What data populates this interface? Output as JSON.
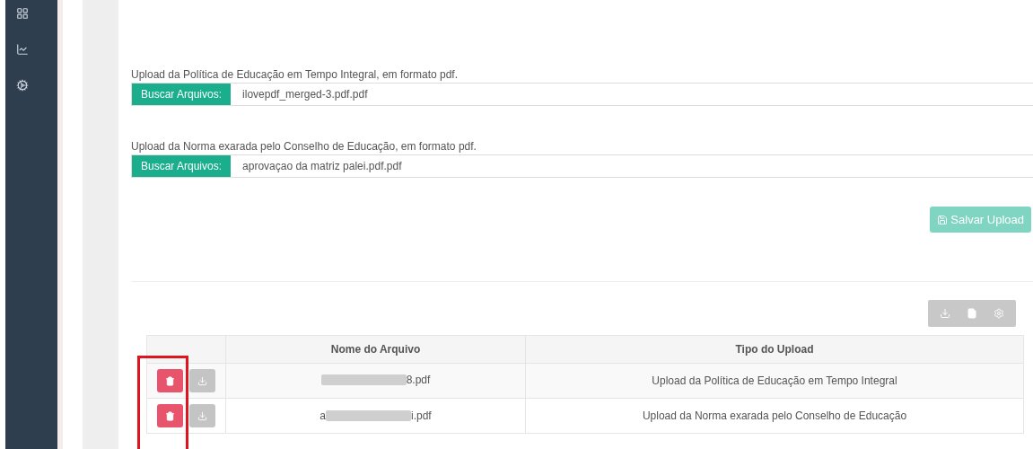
{
  "uploads": [
    {
      "label": "Upload da Política de Educação em Tempo Integral, em formato pdf.",
      "button": "Buscar Arquivos:",
      "value": "ilovepdf_merged-3.pdf.pdf"
    },
    {
      "label": "Upload da Norma exarada pelo Conselho de Educação, em formato pdf.",
      "button": "Buscar Arquivos:",
      "value": "aprovaçao da matriz palei.pdf.pdf"
    }
  ],
  "save_button": {
    "label": "Salvar Upload",
    "disabled": true
  },
  "table": {
    "columns": [
      "Nome do Arquivo",
      "Tipo do Upload"
    ],
    "rows": [
      {
        "file_start": "",
        "file_end": "8.pdf",
        "type": "Upload da Política de Educação em Tempo Integral"
      },
      {
        "file_start": "a",
        "file_end": "i.pdf",
        "type": "Upload da Norma exarada pelo Conselho de Educação"
      }
    ]
  },
  "highlight": {
    "shown": true
  }
}
